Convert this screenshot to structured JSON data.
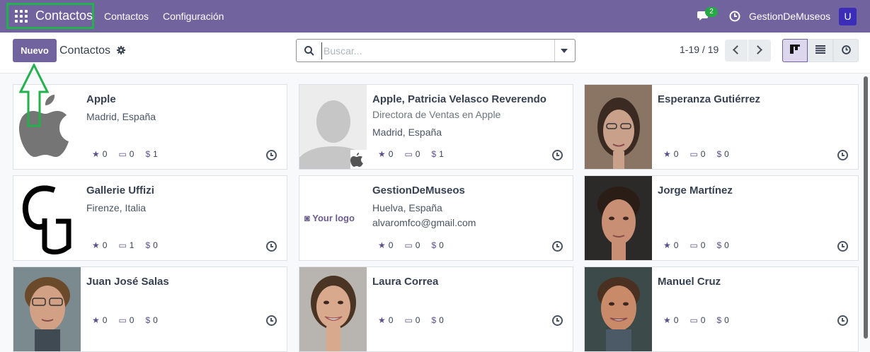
{
  "navbar": {
    "brand": "Contactos",
    "menu": [
      "Contactos",
      "Configuración"
    ],
    "chat_badge": "2",
    "company": "GestionDeMuseos",
    "user_initial": "U",
    "colors": {
      "bar": "#71639e",
      "highlight": "#22b14c"
    }
  },
  "control": {
    "new_label": "Nuevo",
    "breadcrumb": "Contactos",
    "search_placeholder": "Buscar...",
    "pager": "1-19 / 19",
    "views": [
      "kanban",
      "list",
      "activity"
    ]
  },
  "cards": [
    {
      "name": "Apple",
      "subtitle": "",
      "lines": [
        "Madrid, España"
      ],
      "stats": [
        "0",
        "0",
        "1"
      ],
      "image": "apple-logo"
    },
    {
      "name": "Apple, Patricia Velasco Reverendo",
      "subtitle": "Directora de Ventas en Apple",
      "lines": [
        "Madrid, España"
      ],
      "stats": [
        "0",
        "0",
        "1"
      ],
      "image": "placeholder-person-apple"
    },
    {
      "name": "Esperanza Gutiérrez",
      "subtitle": "",
      "lines": [],
      "stats": [
        "0",
        "0",
        "0"
      ],
      "image": "photo-woman-glasses"
    },
    {
      "name": "Gallerie Uffizi",
      "subtitle": "",
      "lines": [
        "Firenze, Italia"
      ],
      "stats": [
        "0",
        "1",
        "0"
      ],
      "image": "uffizi-logo"
    },
    {
      "name": "GestionDeMuseos",
      "subtitle": "",
      "lines": [
        "Huelva, España",
        "alvaromfco@gmail.com"
      ],
      "stats": [
        "0",
        "0",
        "0"
      ],
      "image": "your-logo",
      "logo_text": "Your logo"
    },
    {
      "name": "Jorge Martínez",
      "subtitle": "",
      "lines": [],
      "stats": [
        "0",
        "0",
        "0"
      ],
      "image": "photo-young-man"
    },
    {
      "name": "Juan José Salas",
      "subtitle": "",
      "lines": [],
      "stats": [
        "0",
        "0",
        "0"
      ],
      "image": "photo-man-glasses"
    },
    {
      "name": "Laura Correa",
      "subtitle": "",
      "lines": [],
      "stats": [
        "0",
        "0",
        "0"
      ],
      "image": "photo-woman-smiling"
    },
    {
      "name": "Manuel Cruz",
      "subtitle": "",
      "lines": [],
      "stats": [
        "0",
        "0",
        "0"
      ],
      "image": "photo-man-smiling"
    }
  ]
}
